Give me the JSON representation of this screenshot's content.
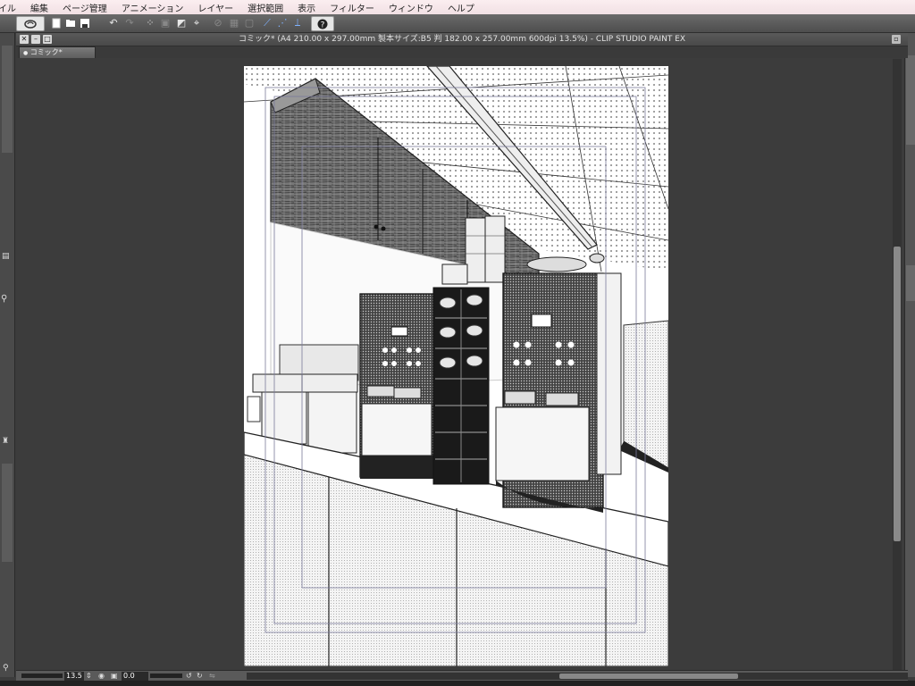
{
  "menu": [
    "イル",
    "編集",
    "ページ管理",
    "アニメーション",
    "レイヤー",
    "選択範囲",
    "表示",
    "フィルター",
    "ウィンドウ",
    "ヘルプ"
  ],
  "toolbar_icons": [
    "clip-studio-icon",
    "new-file-icon",
    "open-file-icon",
    "save-icon",
    "undo-icon",
    "redo-icon",
    "transform-icon",
    "fit-icon",
    "flip-icon",
    "rotate-icon",
    "snap-ruler-icon",
    "snap-special-ruler-icon",
    "snap-grid-icon",
    "help-icon"
  ],
  "window": {
    "title": "コミック* (A4 210.00 x 297.00mm 製本サイズ:B5 判 182.00 x 257.00mm 600dpi 13.5%)  - CLIP STUDIO PAINT EX",
    "tab_label": "コミック*"
  },
  "status": {
    "zoom": "13.5",
    "rotation": "0.0"
  },
  "colors": {
    "menubar": "#f6e8ec",
    "workspace": "#3c3c3c",
    "canvas": "#ffffff",
    "frame_guides": "#7a7a9a"
  }
}
